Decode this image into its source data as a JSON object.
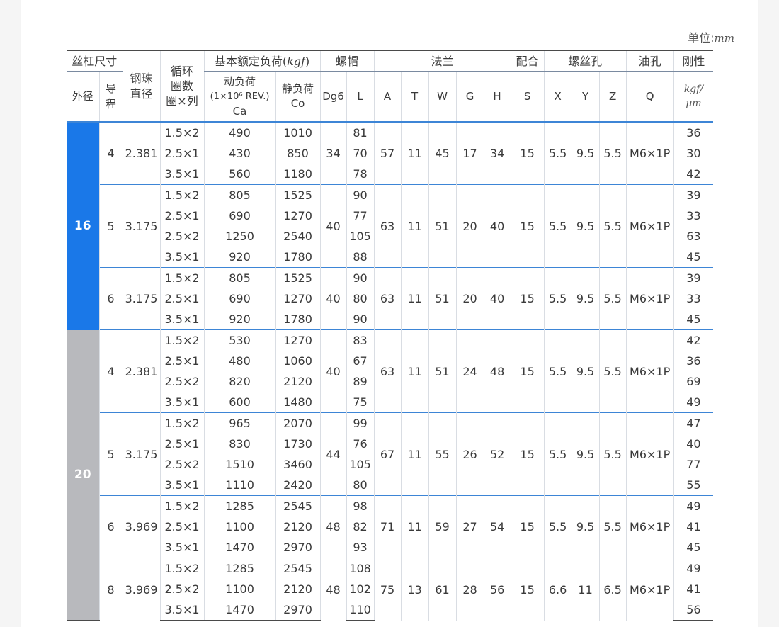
{
  "unit_label": "单位:",
  "unit_value": "mm",
  "headers": {
    "screw_size": "丝杠尺寸",
    "ball_dia": "钢珠直径",
    "circuits": "循环",
    "circuits_sub1": "圈数",
    "circuits_sub2": "圈×列",
    "load_rating": "基本额定负荷(",
    "load_rating_unit": "kgf",
    "load_rating_close": ")",
    "nut": "螺帽",
    "flange": "法兰",
    "fit": "配合",
    "bolt_hole": "螺丝孔",
    "oil_hole": "油孔",
    "rigidity": "刚性",
    "od": "外径",
    "lead": "导程",
    "dyn1": "动负荷",
    "dyn2": "(1×10⁶ REV.)",
    "dyn3": "Ca",
    "sta1": "静负荷",
    "sta2": "Co",
    "dg6": "Dg6",
    "l": "L",
    "a": "A",
    "t": "T",
    "w": "W",
    "g": "G",
    "h": "H",
    "s": "S",
    "x": "X",
    "y": "Y",
    "z": "Z",
    "q": "Q",
    "rig_unit1": "kgf/",
    "rig_unit2": "μm"
  },
  "od_colors": {
    "16": "#1a78e8",
    "20": "#b8b9bd"
  },
  "groups": [
    {
      "od": "16",
      "lead": "4",
      "ball": "2.381",
      "dg6": "34",
      "a": "57",
      "t": "11",
      "w": "45",
      "g": "17",
      "h": "34",
      "s": "15",
      "x": "5.5",
      "y": "9.5",
      "z": "5.5",
      "q": "M6×1P",
      "rows": [
        {
          "turns": "1.5×2",
          "ca": "490",
          "co": "1010",
          "l": "81",
          "k": "36"
        },
        {
          "turns": "2.5×1",
          "ca": "430",
          "co": "850",
          "l": "70",
          "k": "30"
        },
        {
          "turns": "3.5×1",
          "ca": "560",
          "co": "1180",
          "l": "78",
          "k": "42"
        }
      ]
    },
    {
      "od": "16",
      "lead": "5",
      "ball": "3.175",
      "dg6": "40",
      "a": "63",
      "t": "11",
      "w": "51",
      "g": "20",
      "h": "40",
      "s": "15",
      "x": "5.5",
      "y": "9.5",
      "z": "5.5",
      "q": "M6×1P",
      "rows": [
        {
          "turns": "1.5×2",
          "ca": "805",
          "co": "1525",
          "l": "90",
          "k": "39"
        },
        {
          "turns": "2.5×1",
          "ca": "690",
          "co": "1270",
          "l": "77",
          "k": "33"
        },
        {
          "turns": "2.5×2",
          "ca": "1250",
          "co": "2540",
          "l": "105",
          "k": "63"
        },
        {
          "turns": "3.5×1",
          "ca": "920",
          "co": "1780",
          "l": "88",
          "k": "45"
        }
      ]
    },
    {
      "od": "16",
      "lead": "6",
      "ball": "3.175",
      "dg6": "40",
      "a": "63",
      "t": "11",
      "w": "51",
      "g": "20",
      "h": "40",
      "s": "15",
      "x": "5.5",
      "y": "9.5",
      "z": "5.5",
      "q": "M6×1P",
      "rows": [
        {
          "turns": "1.5×2",
          "ca": "805",
          "co": "1525",
          "l": "90",
          "k": "39"
        },
        {
          "turns": "2.5×1",
          "ca": "690",
          "co": "1270",
          "l": "80",
          "k": "33"
        },
        {
          "turns": "3.5×1",
          "ca": "920",
          "co": "1780",
          "l": "90",
          "k": "45"
        }
      ]
    },
    {
      "od": "20",
      "lead": "4",
      "ball": "2.381",
      "dg6": "40",
      "a": "63",
      "t": "11",
      "w": "51",
      "g": "24",
      "h": "48",
      "s": "15",
      "x": "5.5",
      "y": "9.5",
      "z": "5.5",
      "q": "M6×1P",
      "rows": [
        {
          "turns": "1.5×2",
          "ca": "530",
          "co": "1270",
          "l": "83",
          "k": "42"
        },
        {
          "turns": "2.5×1",
          "ca": "480",
          "co": "1060",
          "l": "67",
          "k": "36"
        },
        {
          "turns": "2.5×2",
          "ca": "820",
          "co": "2120",
          "l": "89",
          "k": "69"
        },
        {
          "turns": "3.5×1",
          "ca": "600",
          "co": "1480",
          "l": "75",
          "k": "49"
        }
      ]
    },
    {
      "od": "20",
      "lead": "5",
      "ball": "3.175",
      "dg6": "44",
      "a": "67",
      "t": "11",
      "w": "55",
      "g": "26",
      "h": "52",
      "s": "15",
      "x": "5.5",
      "y": "9.5",
      "z": "5.5",
      "q": "M6×1P",
      "rows": [
        {
          "turns": "1.5×2",
          "ca": "965",
          "co": "2070",
          "l": "99",
          "k": "47"
        },
        {
          "turns": "2.5×1",
          "ca": "830",
          "co": "1730",
          "l": "76",
          "k": "40"
        },
        {
          "turns": "2.5×2",
          "ca": "1510",
          "co": "3460",
          "l": "105",
          "k": "77"
        },
        {
          "turns": "3.5×1",
          "ca": "1110",
          "co": "2420",
          "l": "80",
          "k": "55"
        }
      ]
    },
    {
      "od": "20",
      "lead": "6",
      "ball": "3.969",
      "dg6": "48",
      "a": "71",
      "t": "11",
      "w": "59",
      "g": "27",
      "h": "54",
      "s": "15",
      "x": "5.5",
      "y": "9.5",
      "z": "5.5",
      "q": "M6×1P",
      "rows": [
        {
          "turns": "1.5×2",
          "ca": "1285",
          "co": "2545",
          "l": "98",
          "k": "49"
        },
        {
          "turns": "2.5×1",
          "ca": "1100",
          "co": "2120",
          "l": "82",
          "k": "41"
        },
        {
          "turns": "3.5×1",
          "ca": "1470",
          "co": "2970",
          "l": "93",
          "k": "45"
        }
      ]
    },
    {
      "od": "20",
      "lead": "8",
      "ball": "3.969",
      "dg6": "48",
      "a": "75",
      "t": "13",
      "w": "61",
      "g": "28",
      "h": "56",
      "s": "15",
      "x": "6.6",
      "y": "11",
      "z": "6.5",
      "q": "M6×1P",
      "rows": [
        {
          "turns": "1.5×2",
          "ca": "1285",
          "co": "2545",
          "l": "108",
          "k": "49"
        },
        {
          "turns": "2.5×2",
          "ca": "1100",
          "co": "2120",
          "l": "102",
          "k": "41"
        },
        {
          "turns": "3.5×1",
          "ca": "1470",
          "co": "2970",
          "l": "110",
          "k": "56"
        }
      ]
    }
  ]
}
